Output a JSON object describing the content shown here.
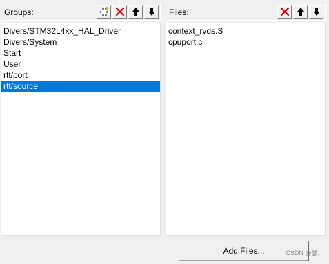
{
  "groups": {
    "title": "Groups:",
    "toolbar": {
      "new_icon": "new-group-icon",
      "delete_icon": "delete-icon",
      "up_icon": "arrow-up-icon",
      "down_icon": "arrow-down-icon"
    },
    "items": [
      "Divers/STM32L4xx_HAL_Driver",
      "Divers/System",
      "Start",
      "User",
      "rtt/port",
      "rtt/source"
    ],
    "selected_index": 5
  },
  "files": {
    "title": "Files:",
    "toolbar": {
      "delete_icon": "delete-icon",
      "up_icon": "arrow-up-icon",
      "down_icon": "arrow-down-icon"
    },
    "items": [
      "context_rvds.S",
      "cpuport.c"
    ]
  },
  "buttons": {
    "add_files": "Add Files..."
  },
  "watermark": "CSDN @瑟.",
  "colors": {
    "selection": "#0078d7",
    "delete_red": "#cc0000"
  }
}
